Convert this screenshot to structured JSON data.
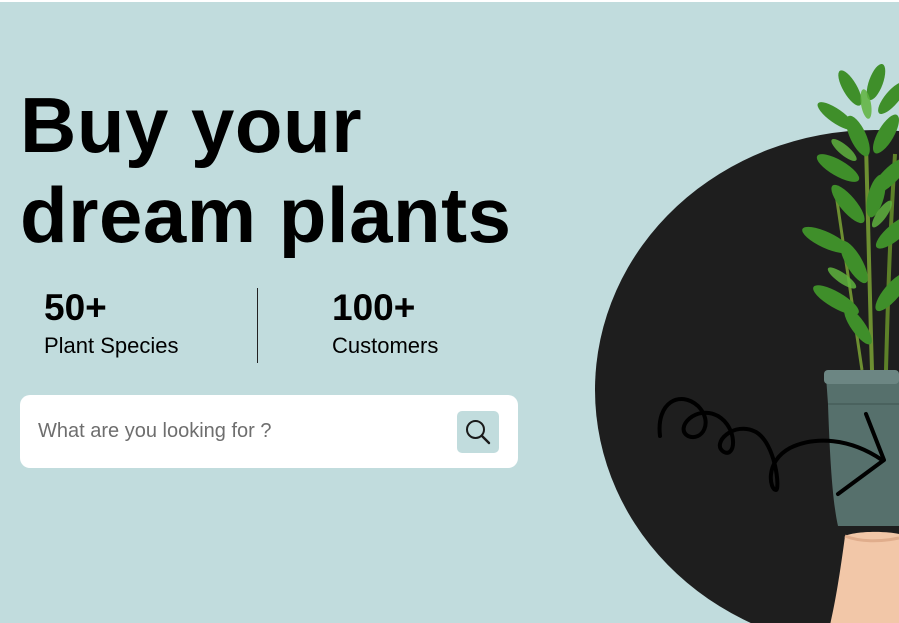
{
  "hero": {
    "headline_line1": "Buy your",
    "headline_line2": "dream plants",
    "background_color": "#c1dcdd",
    "circle_color": "#1e1e1e"
  },
  "stats": [
    {
      "value": "50+",
      "label": "Plant Species"
    },
    {
      "value": "100+",
      "label": "Customers"
    }
  ],
  "search": {
    "placeholder": "What are you looking for ?",
    "value": "",
    "button_icon": "search-icon"
  },
  "illustration": {
    "image": "potted-plant-in-hand",
    "decoration": "squiggle-arrow"
  }
}
